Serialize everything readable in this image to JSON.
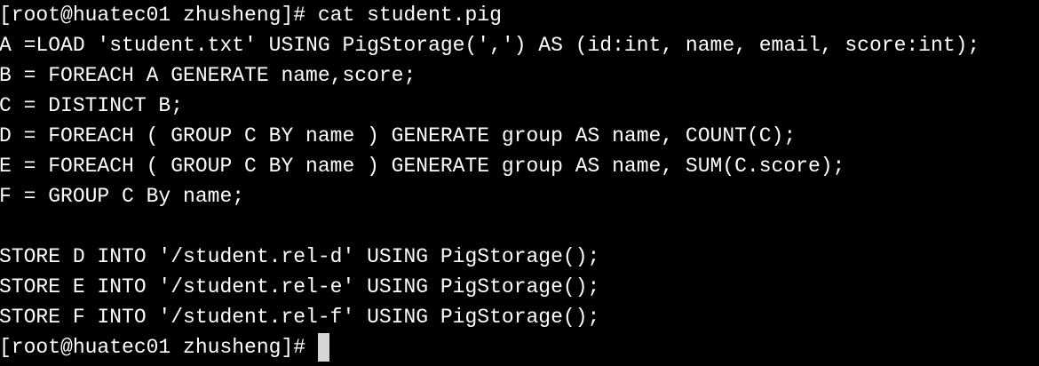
{
  "terminal": {
    "prompt": "[root@huatec01 zhusheng]#",
    "command": "cat student.pig",
    "output": [
      "A =LOAD 'student.txt' USING PigStorage(',') AS (id:int, name, email, score:int);",
      "B = FOREACH A GENERATE name,score;",
      "C = DISTINCT B;",
      "D = FOREACH ( GROUP C BY name ) GENERATE group AS name, COUNT(C);",
      "E = FOREACH ( GROUP C BY name ) GENERATE group AS name, SUM(C.score);",
      "F = GROUP C By name;",
      "",
      "STORE D INTO '/student.rel-d' USING PigStorage();",
      "STORE E INTO '/student.rel-e' USING PigStorage();",
      "STORE F INTO '/student.rel-f' USING PigStorage();"
    ],
    "final_prompt": "[root@huatec01 zhusheng]#"
  },
  "colors": {
    "background": "#000000",
    "foreground": "#ffffff",
    "cursor": "#d6d6d6"
  }
}
